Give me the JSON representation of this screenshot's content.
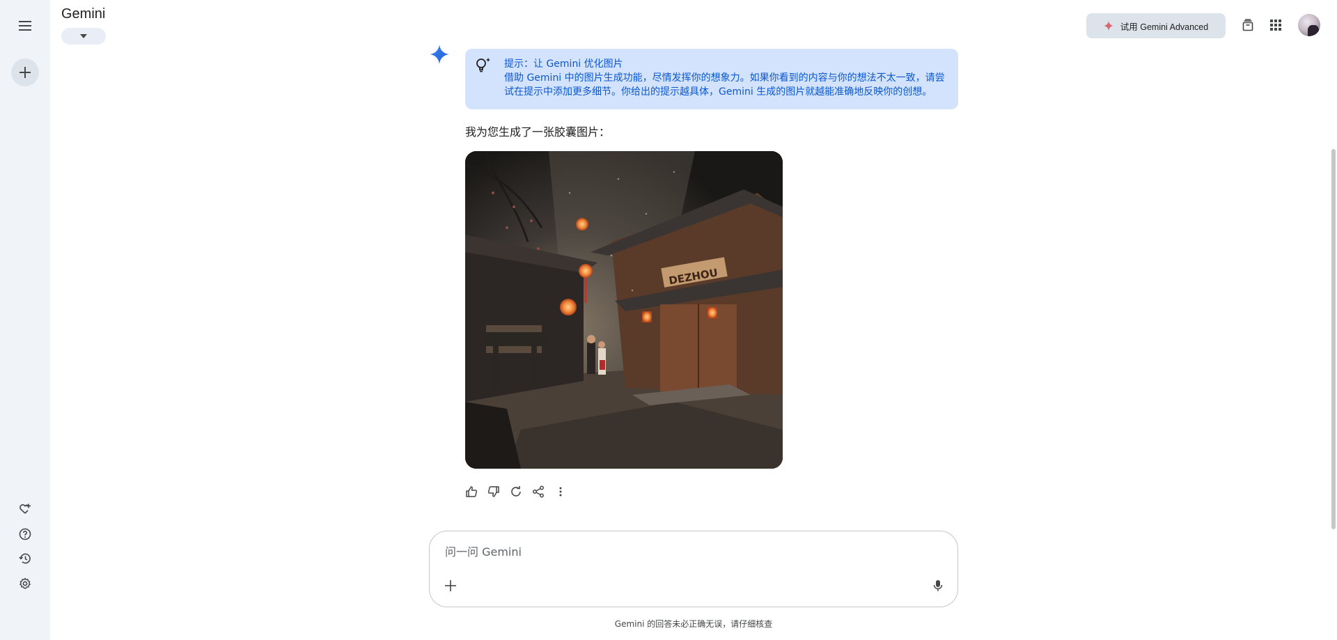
{
  "header": {
    "app_title": "Gemini",
    "model_dropdown_icon": "caret-down-icon",
    "advanced_button_label": "试用 Gemini Advanced",
    "advanced_icon": "sparkle-icon"
  },
  "sidebar": {
    "menu_icon": "hamburger-icon",
    "new_chat_icon": "plus-icon",
    "bottom_items": [
      {
        "name": "gem-manager",
        "icon": "heart-plus-icon"
      },
      {
        "name": "help",
        "icon": "help-icon"
      },
      {
        "name": "activity",
        "icon": "history-icon"
      },
      {
        "name": "settings",
        "icon": "gear-icon"
      }
    ]
  },
  "conversation": {
    "tip": {
      "title": "提示：让 Gemini 优化图片",
      "body": "借助 Gemini 中的图片生成功能，尽情发挥你的想象力。如果你看到的内容与你的想法不太一致，请尝试在提示中添加更多细节。你给出的提示越具体，Gemini 生成的图片就越能准确地反映你的创想。"
    },
    "reply_text": "我为您生成了一张胶囊图片：",
    "image_sign_text": "DEZHOU",
    "actions": [
      "thumb-up-icon",
      "thumb-down-icon",
      "regenerate-icon",
      "share-icon",
      "more-vert-icon"
    ]
  },
  "input": {
    "placeholder": "问一问 Gemini",
    "value": ""
  },
  "footer": {
    "disclaimer": "Gemini 的回答未必正确无误，请仔细核查"
  },
  "colors": {
    "rail_bg": "#f0f4f9",
    "tip_bg": "#d3e3fd",
    "tip_text": "#0b57d0",
    "accent_blue": "#1a73e8",
    "advanced_sparkle": "#d96570"
  }
}
